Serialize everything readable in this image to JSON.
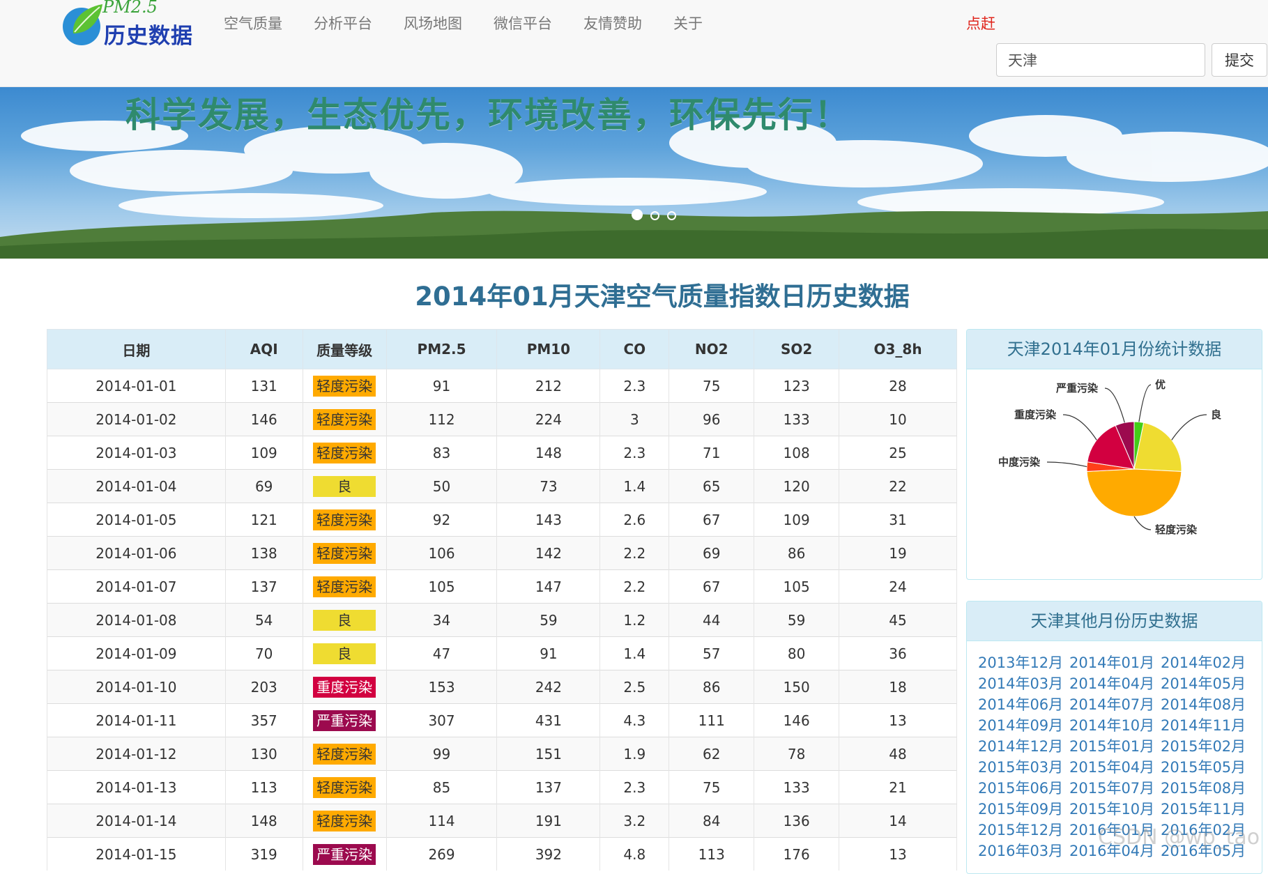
{
  "nav": {
    "logo_pm": "PM2.5",
    "logo_title": "历史数据",
    "links": [
      "空气质量",
      "分析平台",
      "风场地图",
      "微信平台",
      "友情赞助",
      "关于"
    ],
    "hot_link": "点赶"
  },
  "search": {
    "value": "天津",
    "submit_label": "提交"
  },
  "banner": {
    "slogan": "科学发展，生态优先，环境改善，环保先行！"
  },
  "page_title": "2014年01月天津空气质量指数日历史数据",
  "table": {
    "headers": [
      "日期",
      "AQI",
      "质量等级",
      "PM2.5",
      "PM10",
      "CO",
      "NO2",
      "SO2",
      "O3_8h"
    ],
    "rows": [
      [
        "2014-01-01",
        "131",
        "轻度污染",
        "91",
        "212",
        "2.3",
        "75",
        "123",
        "28"
      ],
      [
        "2014-01-02",
        "146",
        "轻度污染",
        "112",
        "224",
        "3",
        "96",
        "133",
        "10"
      ],
      [
        "2014-01-03",
        "109",
        "轻度污染",
        "83",
        "148",
        "2.3",
        "71",
        "108",
        "25"
      ],
      [
        "2014-01-04",
        "69",
        "良",
        "50",
        "73",
        "1.4",
        "65",
        "120",
        "22"
      ],
      [
        "2014-01-05",
        "121",
        "轻度污染",
        "92",
        "143",
        "2.6",
        "67",
        "109",
        "31"
      ],
      [
        "2014-01-06",
        "138",
        "轻度污染",
        "106",
        "142",
        "2.2",
        "69",
        "86",
        "19"
      ],
      [
        "2014-01-07",
        "137",
        "轻度污染",
        "105",
        "147",
        "2.2",
        "67",
        "105",
        "24"
      ],
      [
        "2014-01-08",
        "54",
        "良",
        "34",
        "59",
        "1.2",
        "44",
        "59",
        "45"
      ],
      [
        "2014-01-09",
        "70",
        "良",
        "47",
        "91",
        "1.4",
        "57",
        "80",
        "36"
      ],
      [
        "2014-01-10",
        "203",
        "重度污染",
        "153",
        "242",
        "2.5",
        "86",
        "150",
        "18"
      ],
      [
        "2014-01-11",
        "357",
        "严重污染",
        "307",
        "431",
        "4.3",
        "111",
        "146",
        "13"
      ],
      [
        "2014-01-12",
        "130",
        "轻度污染",
        "99",
        "151",
        "1.9",
        "62",
        "78",
        "48"
      ],
      [
        "2014-01-13",
        "113",
        "轻度污染",
        "85",
        "137",
        "2.3",
        "75",
        "133",
        "21"
      ],
      [
        "2014-01-14",
        "148",
        "轻度污染",
        "114",
        "191",
        "3.2",
        "84",
        "136",
        "14"
      ],
      [
        "2014-01-15",
        "319",
        "严重污染",
        "269",
        "392",
        "4.8",
        "113",
        "176",
        "13"
      ]
    ],
    "level_colors": {
      "良": {
        "bg": "#efdc31",
        "fg": "#333333"
      },
      "轻度污染": {
        "bg": "#ffaa00",
        "fg": "#333333"
      },
      "中度污染": {
        "bg": "#ff401a",
        "fg": "#ffffff"
      },
      "重度污染": {
        "bg": "#d20040",
        "fg": "#ffffff"
      },
      "严重污染": {
        "bg": "#9c0a4e",
        "fg": "#ffffff"
      }
    }
  },
  "stats_panel": {
    "title": "天津2014年01月份统计数据",
    "chart_data": {
      "type": "pie",
      "slices": [
        {
          "label": "优",
          "value": 1,
          "color": "#43ce17"
        },
        {
          "label": "良",
          "value": 7,
          "color": "#efdc31"
        },
        {
          "label": "轻度污染",
          "value": 15,
          "color": "#ffaa00"
        },
        {
          "label": "中度污染",
          "value": 1,
          "color": "#ff401a"
        },
        {
          "label": "重度污染",
          "value": 5,
          "color": "#d20040"
        },
        {
          "label": "严重污染",
          "value": 2,
          "color": "#9c0a4e"
        }
      ]
    }
  },
  "months_panel": {
    "title": "天津其他月份历史数据",
    "months": [
      "2013年12月",
      "2014年01月",
      "2014年02月",
      "2014年03月",
      "2014年04月",
      "2014年05月",
      "2014年06月",
      "2014年07月",
      "2014年08月",
      "2014年09月",
      "2014年10月",
      "2014年11月",
      "2014年12月",
      "2015年01月",
      "2015年02月",
      "2015年03月",
      "2015年04月",
      "2015年05月",
      "2015年06月",
      "2015年07月",
      "2015年08月",
      "2015年09月",
      "2015年10月",
      "2015年11月",
      "2015年12月",
      "2016年01月",
      "2016年02月",
      "2016年03月",
      "2016年04月",
      "2016年05月"
    ]
  },
  "watermark": "CSDN @wp_tao"
}
